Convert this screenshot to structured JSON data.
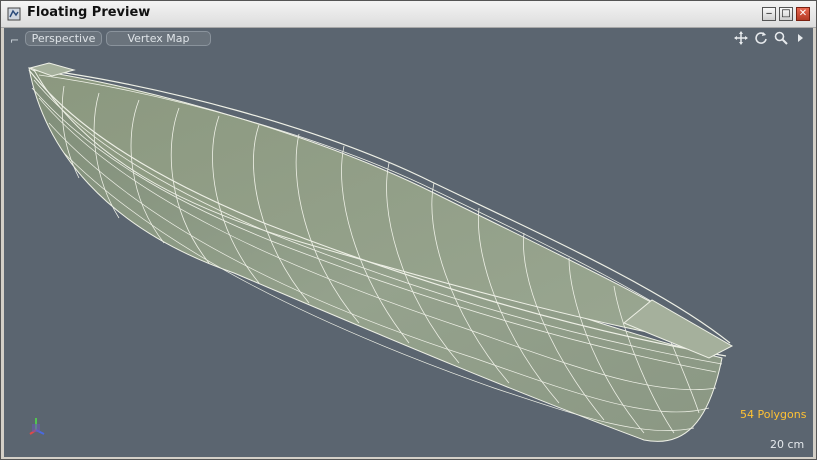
{
  "window": {
    "title": "Floating Preview"
  },
  "viewport": {
    "view_mode": "Perspective",
    "shading_mode": "Vertex Map",
    "polygon_count": "54 Polygons",
    "scale": "20 cm"
  },
  "icons": {
    "app": "app-icon",
    "minimize": "minimize-icon",
    "maximize": "maximize-icon",
    "close": "close-icon",
    "pan": "pan-icon",
    "rotate": "rotate-icon",
    "zoom": "zoom-icon",
    "more": "play-icon",
    "axis": "axis-gizmo-icon"
  },
  "colors": {
    "viewport_bg": "#5b6570",
    "mesh_fill": "#8c9a84",
    "wire": "#eef0e6",
    "polygon_count_text": "#ffc233",
    "scale_text": "#e4e8ec"
  }
}
